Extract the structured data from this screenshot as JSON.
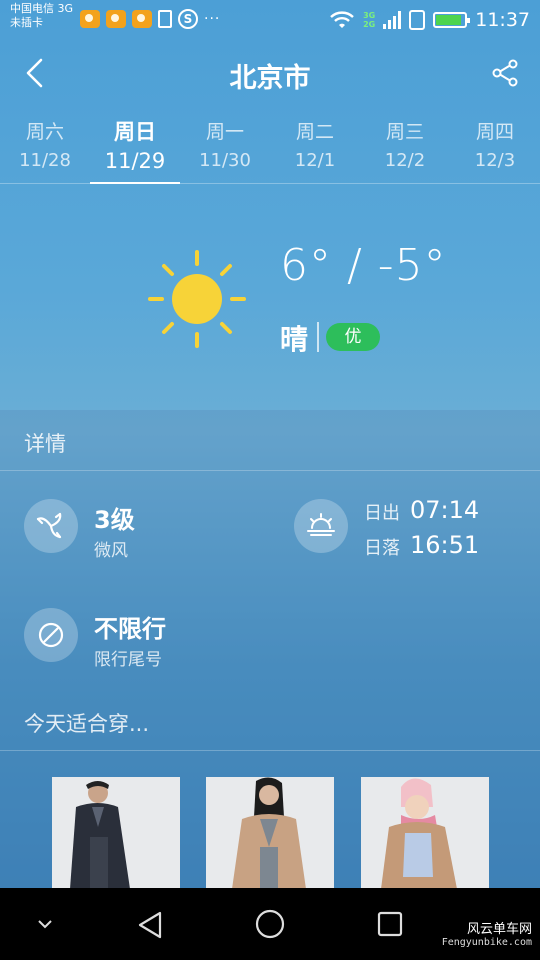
{
  "status_bar": {
    "carrier_line1": "中国电信 3G",
    "carrier_line2": "未插卡",
    "network_top": "3G",
    "network_bottom": "2G",
    "time": "11:37",
    "battery_level": 0.9
  },
  "header": {
    "city": "北京市",
    "back_icon": "chevron-left-icon",
    "share_icon": "share-icon"
  },
  "days": [
    {
      "name": "周六",
      "date": "11/28",
      "active": false
    },
    {
      "name": "周日",
      "date": "11/29",
      "active": true
    },
    {
      "name": "周一",
      "date": "11/30",
      "active": false
    },
    {
      "name": "周二",
      "date": "12/1",
      "active": false
    },
    {
      "name": "周三",
      "date": "12/2",
      "active": false
    },
    {
      "name": "周四",
      "date": "12/3",
      "active": false
    }
  ],
  "weather": {
    "temperature": "6° / -5°",
    "condition": "晴",
    "aqi": "优",
    "aqi_color": "#2dbe5b",
    "sun_color": "#f7d338"
  },
  "details": {
    "title": "详情",
    "wind": {
      "level": "3级",
      "desc": "微风",
      "icon": "wind-icon"
    },
    "sun": {
      "sunrise_label": "日出",
      "sunrise": "07:14",
      "sunset_label": "日落",
      "sunset": "16:51",
      "icon": "sunrise-icon"
    },
    "traffic": {
      "status": "不限行",
      "desc": "限行尾号",
      "icon": "no-restriction-icon"
    }
  },
  "clothing": {
    "title": "今天适合穿...",
    "items": [
      "man-coat-photo",
      "woman-coat-photo",
      "child-coat-photo"
    ]
  },
  "watermark": {
    "line1": "风云单车网",
    "line2": "Fengyunbike.com"
  }
}
